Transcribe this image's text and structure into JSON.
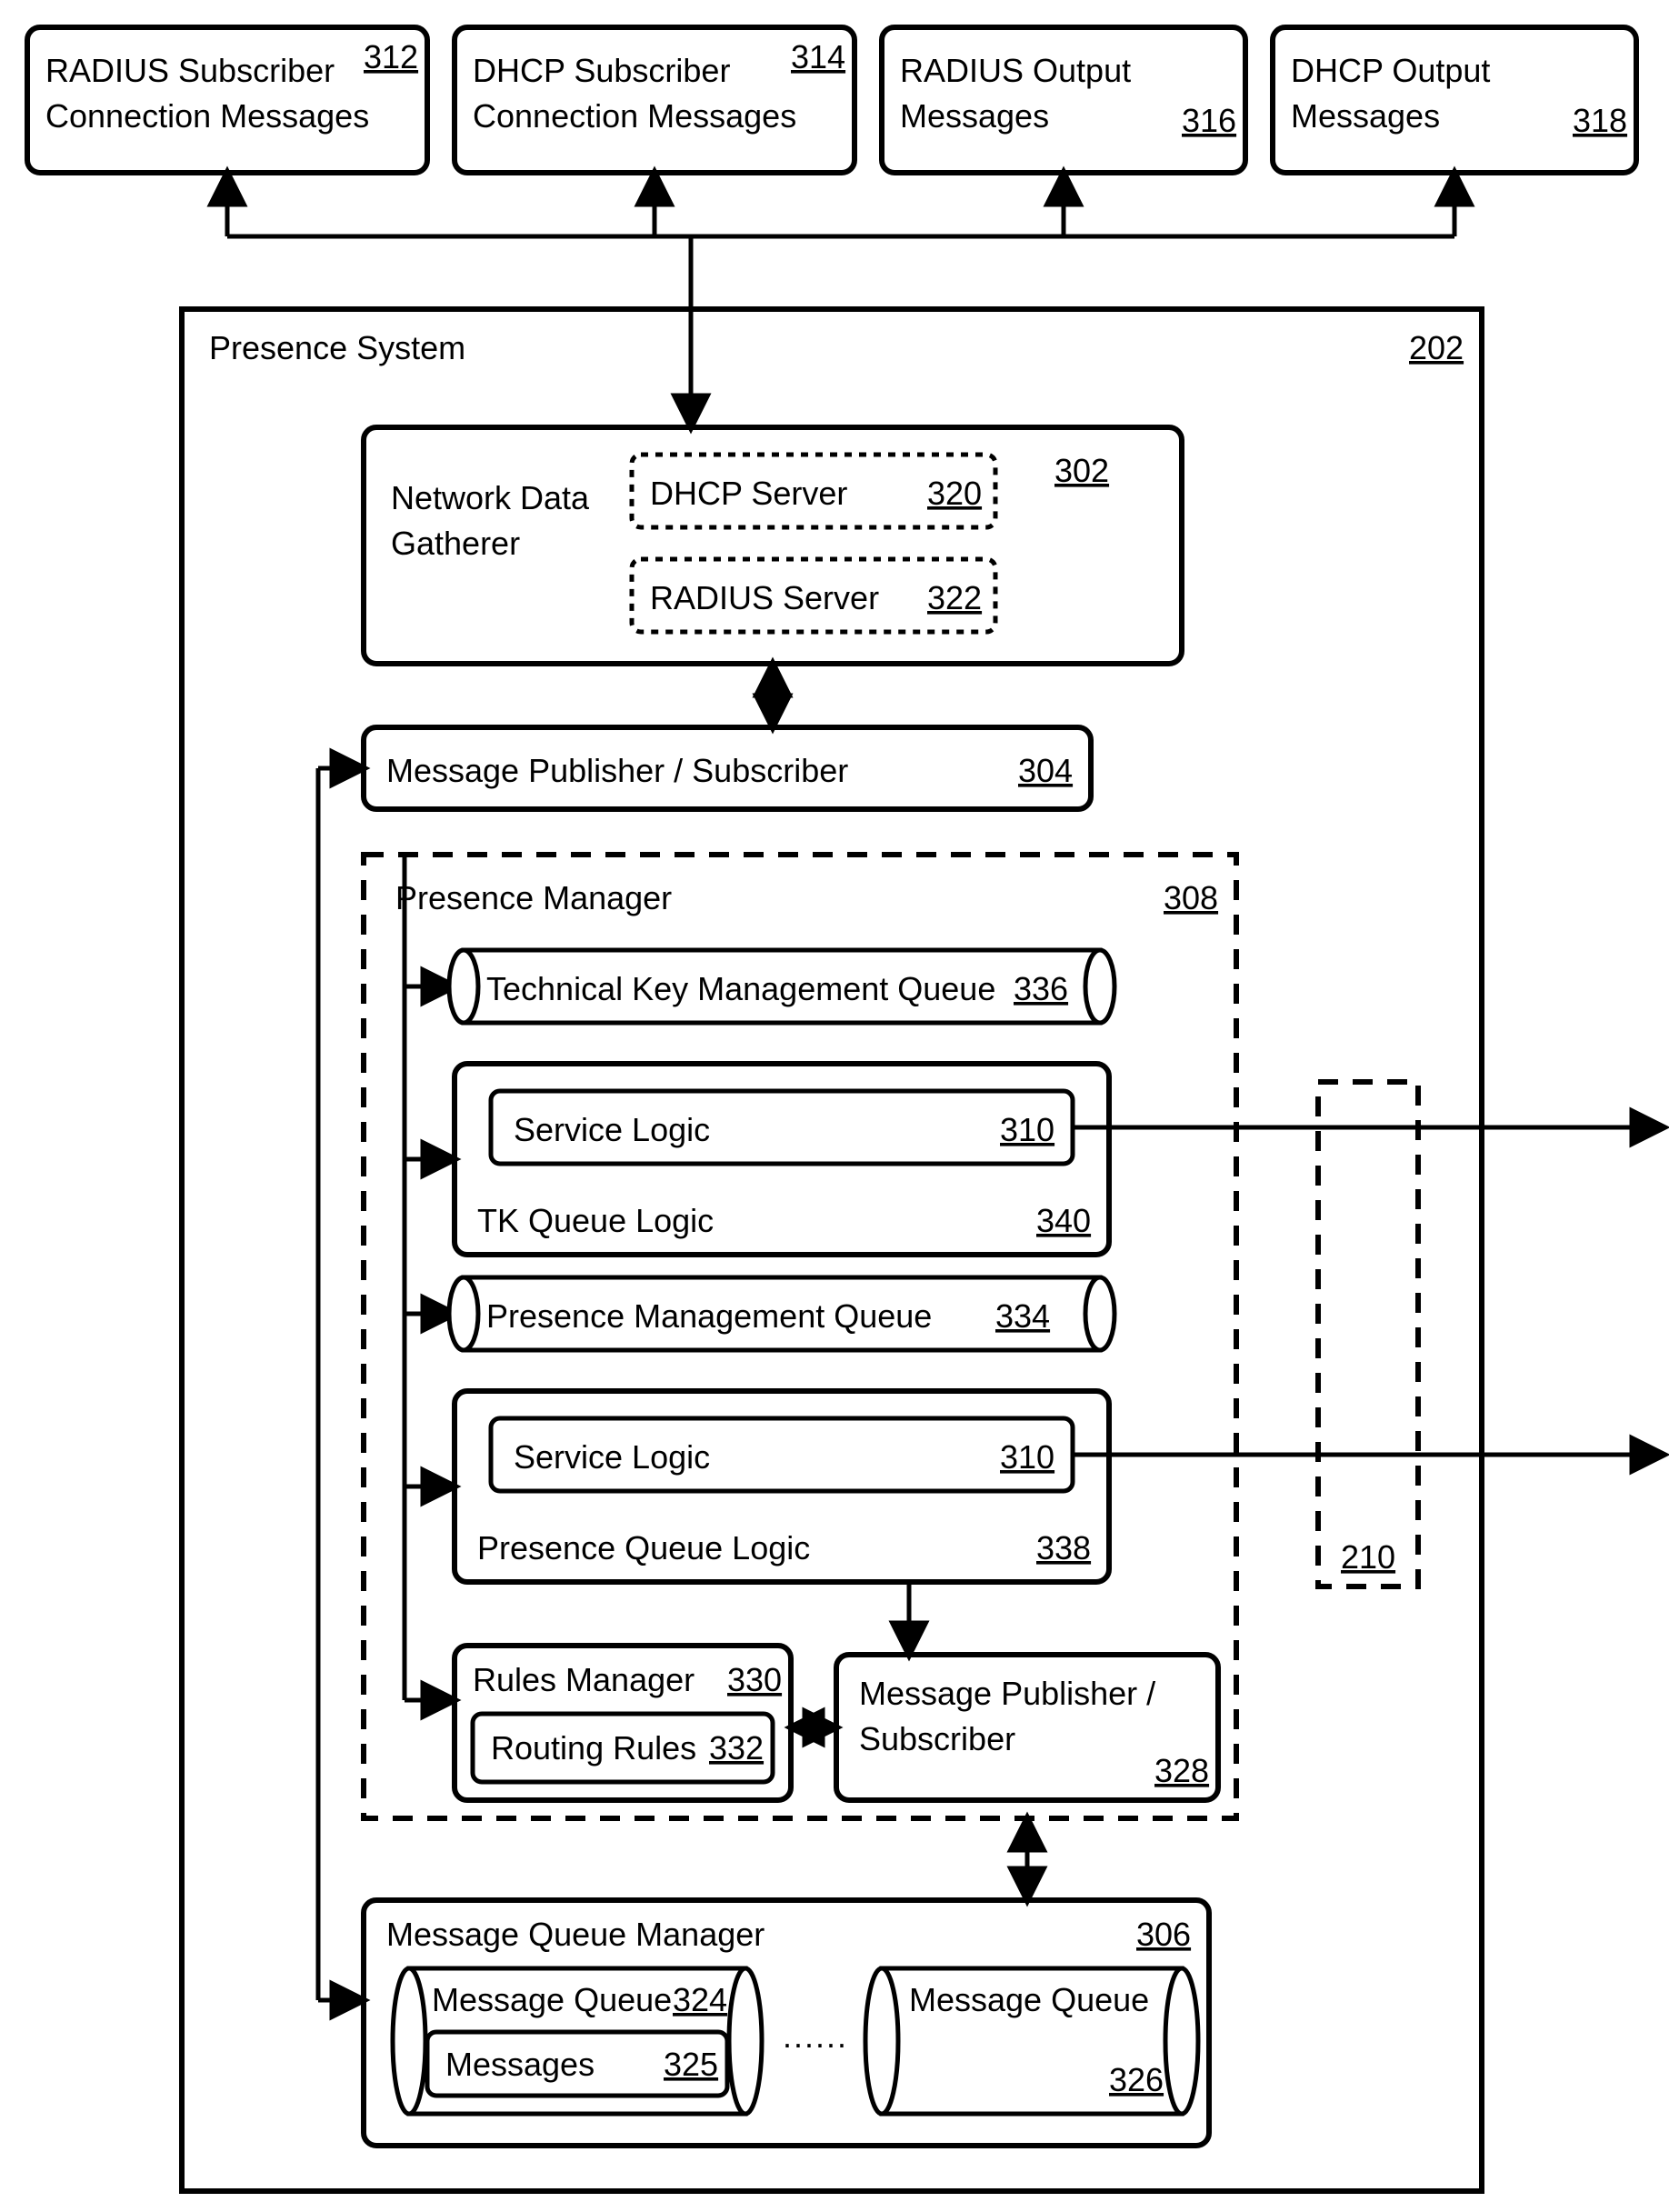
{
  "top_boxes": {
    "radius_sub": {
      "line1": "RADIUS Subscriber",
      "line2": "Connection Messages",
      "num": "312"
    },
    "dhcp_sub": {
      "line1": "DHCP Subscriber",
      "line2": "Connection Messages",
      "num": "314"
    },
    "radius_out": {
      "line1": "RADIUS Output",
      "line2": "Messages",
      "num": "316"
    },
    "dhcp_out": {
      "line1": "DHCP Output",
      "line2": "Messages",
      "num": "318"
    }
  },
  "presence_system": {
    "title": "Presence System",
    "num": "202"
  },
  "gatherer": {
    "title_l1": "Network Data",
    "title_l2": "Gatherer",
    "num": "302",
    "dhcp_server": {
      "label": "DHCP Server",
      "num": "320"
    },
    "radius_server": {
      "label": "RADIUS Server",
      "num": "322"
    }
  },
  "pubsub_top": {
    "label": "Message Publisher / Subscriber",
    "num": "304"
  },
  "presence_manager": {
    "title": "Presence Manager",
    "num": "308",
    "tkm_queue": {
      "label": "Technical Key Management Queue",
      "num": "336"
    },
    "tk_logic": {
      "label": "TK Queue Logic",
      "num": "340"
    },
    "svc1": {
      "label": "Service Logic",
      "num": "310"
    },
    "pm_queue": {
      "label": "Presence Management Queue",
      "num": "334"
    },
    "pq_logic": {
      "label": "Presence Queue Logic",
      "num": "338"
    },
    "svc2": {
      "label": "Service Logic",
      "num": "310"
    },
    "rules_mgr": {
      "label": "Rules Manager",
      "num": "330"
    },
    "routing": {
      "label": "Routing Rules",
      "num": "332"
    },
    "pubsub_inner": {
      "line1": "Message Publisher /",
      "line2": "Subscriber",
      "num": "328"
    }
  },
  "right_ref": {
    "num": "210"
  },
  "mq_manager": {
    "title": "Message Queue Manager",
    "num": "306",
    "q1": {
      "label": "Message Queue",
      "num": "324"
    },
    "msgs": {
      "label": "Messages",
      "num": "325"
    },
    "q2": {
      "label": "Message Queue",
      "num": "326"
    }
  }
}
